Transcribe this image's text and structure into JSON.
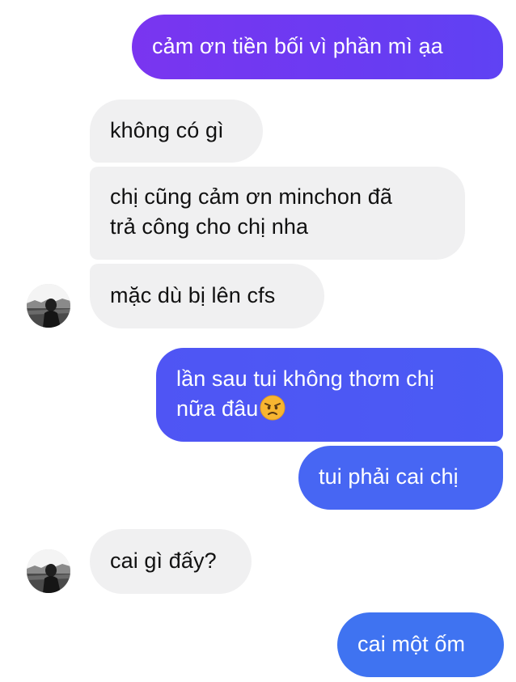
{
  "messages": [
    {
      "id": "m1",
      "from": "me",
      "text": "cảm ơn tiền bối vì phần mì ạa"
    },
    {
      "id": "m2",
      "from": "other",
      "text": "không có gì"
    },
    {
      "id": "m3",
      "from": "other",
      "lines": [
        "chị cũng cảm ơn minchon đã",
        "trả công cho chị nha"
      ]
    },
    {
      "id": "m4",
      "from": "other",
      "text": "mặc dù bị lên cfs"
    },
    {
      "id": "m5",
      "from": "me",
      "lines": [
        "lần sau tui không thơm chị",
        "nữa đâu"
      ],
      "emoji": "angry-face-icon"
    },
    {
      "id": "m6",
      "from": "me",
      "text": "tui phải cai chị"
    },
    {
      "id": "m7",
      "from": "other",
      "text": "cai gì đấy?"
    },
    {
      "id": "m8",
      "from": "me",
      "text": "cai một ốm"
    }
  ],
  "colors": {
    "incoming_bubble": "#f0f0f1",
    "outgoing_purple": "#7a35f0",
    "outgoing_blue": "#3f73f1"
  }
}
